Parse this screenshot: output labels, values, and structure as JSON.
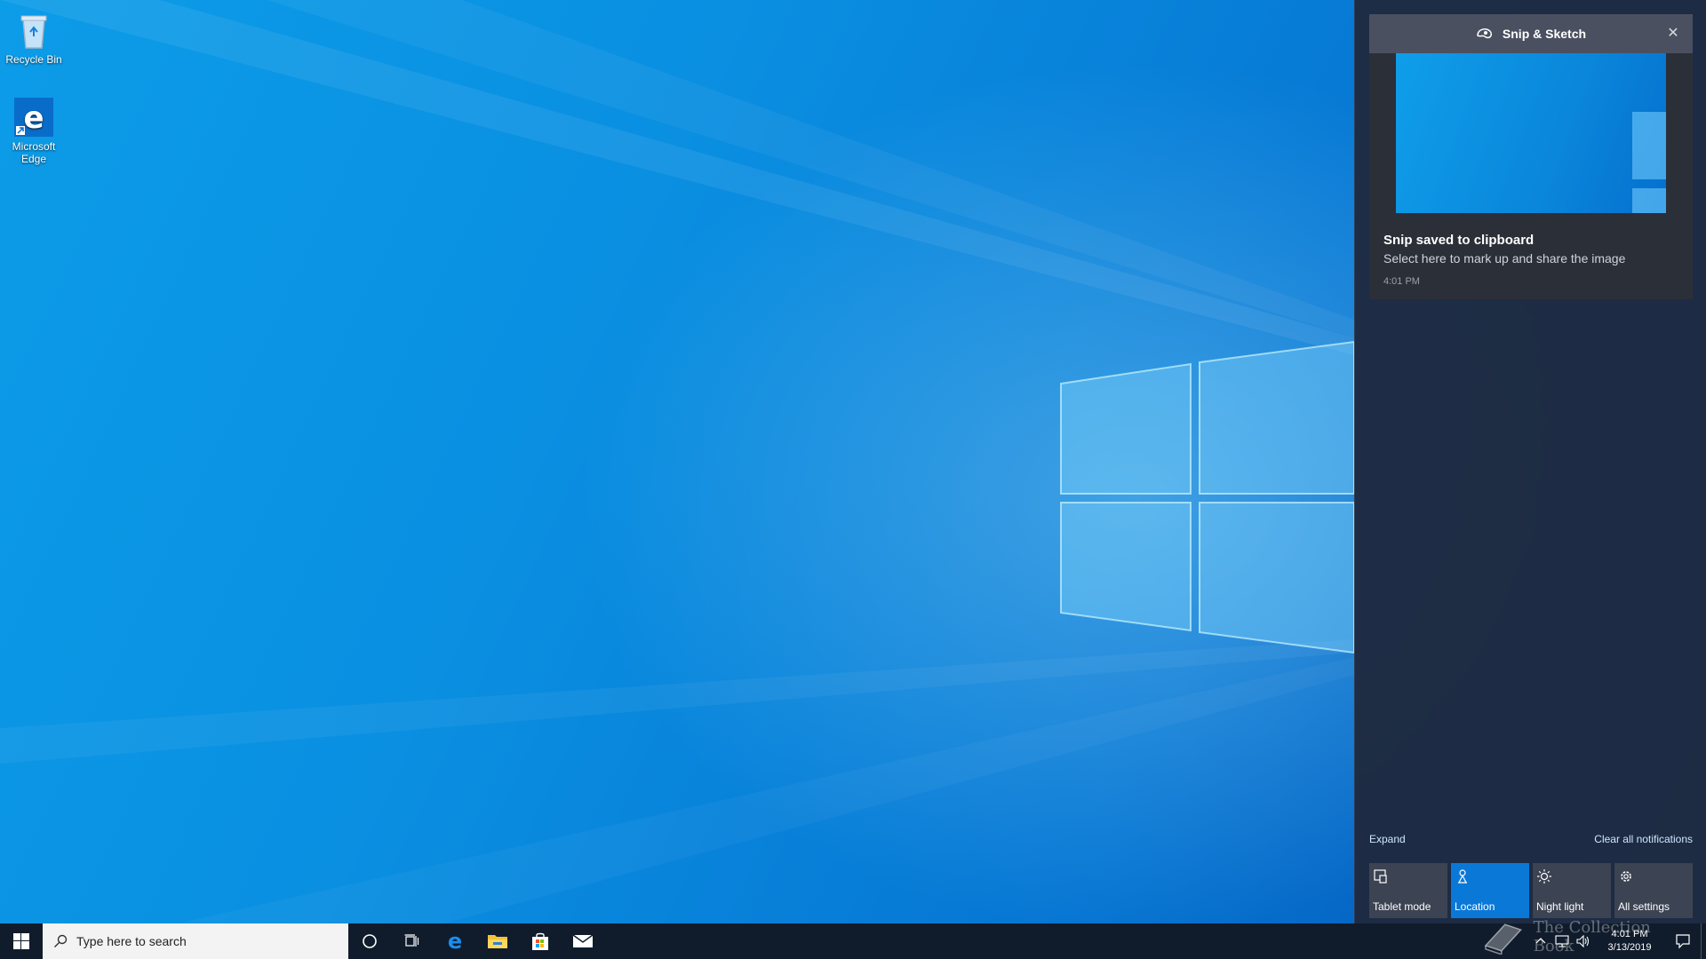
{
  "desktop": {
    "icons": [
      {
        "label": "Recycle Bin",
        "icon": "recycle-bin-icon"
      },
      {
        "label": "Microsoft Edge",
        "icon": "edge-icon"
      }
    ]
  },
  "action_center": {
    "toast": {
      "app_name": "Snip & Sketch",
      "title": "Snip saved to clipboard",
      "text": "Select here to mark up and share the image",
      "time": "4:01 PM"
    },
    "expand_label": "Expand",
    "clear_label": "Clear all notifications",
    "quick_actions": [
      {
        "label": "Tablet mode",
        "icon": "tablet-mode-icon",
        "active": false
      },
      {
        "label": "Location",
        "icon": "location-icon",
        "active": true
      },
      {
        "label": "Night light",
        "icon": "night-light-icon",
        "active": false
      },
      {
        "label": "All settings",
        "icon": "gear-icon",
        "active": false
      }
    ]
  },
  "taskbar": {
    "search_placeholder": "Type here to search",
    "pinned": [
      "cortana-icon",
      "task-view-icon",
      "edge-icon",
      "file-explorer-icon",
      "store-icon",
      "mail-icon"
    ],
    "clock": {
      "time": "4:01 PM",
      "date": "3/13/2019"
    }
  },
  "watermark": "The Collection Book",
  "colors": {
    "accent": "#0a78d7",
    "taskbar": "#101c2c",
    "action_center_bg": "#1e2a3e"
  }
}
